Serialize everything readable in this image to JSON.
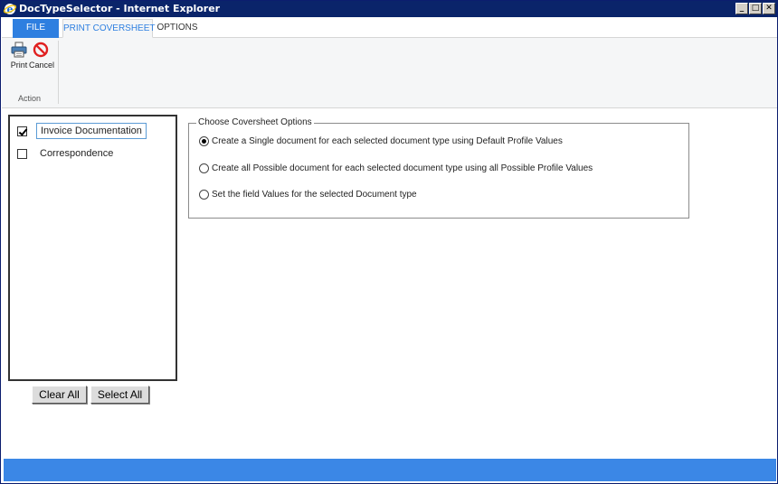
{
  "window": {
    "title": "DocTypeSelector - Internet Explorer",
    "controls": {
      "minimize": "_",
      "maximize": "□",
      "close": "✕"
    }
  },
  "ribbon": {
    "tabs": [
      {
        "label": "FILE",
        "active": false
      },
      {
        "label": "PRINT COVERSHEET",
        "active": true
      },
      {
        "label": "OPTIONS",
        "active": false
      }
    ],
    "buttons": {
      "print": {
        "label": "Print",
        "icon": "printer-icon"
      },
      "cancel": {
        "label": "Cancel",
        "icon": "cancel-icon"
      }
    },
    "group_label": "Action"
  },
  "doc_types": [
    {
      "label": "Invoice Documentation",
      "checked": true,
      "selected": true
    },
    {
      "label": "Correspondence",
      "checked": false,
      "selected": false
    }
  ],
  "list_buttons": {
    "clear_all": "Clear All",
    "select_all": "Select All"
  },
  "coversheet_options": {
    "legend": "Choose Coversheet Options",
    "options": [
      {
        "label": "Create a Single document for each selected document type using Default Profile Values",
        "selected": true
      },
      {
        "label": "Create all Possible document for each selected document type using all Possible Profile Values",
        "selected": false
      },
      {
        "label": "Set the field Values for the selected Document type",
        "selected": false
      }
    ]
  },
  "colors": {
    "titlebar": "#0a246a",
    "accent": "#2e7fe0",
    "statusbar": "#3b87e6",
    "cancel_red": "#e02020"
  }
}
